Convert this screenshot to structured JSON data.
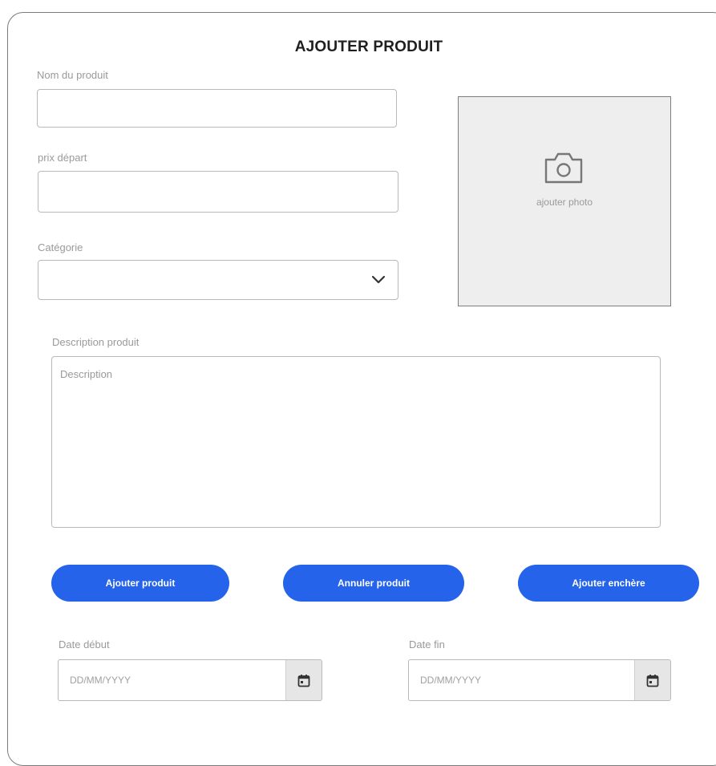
{
  "form": {
    "title": "AJOUTER PRODUIT",
    "product_name": {
      "label": "Nom du produit",
      "value": ""
    },
    "start_price": {
      "label": "prix départ",
      "value": ""
    },
    "category": {
      "label": "Catégorie",
      "selected": ""
    },
    "photo": {
      "label": "ajouter photo",
      "icon": "camera-icon"
    },
    "description": {
      "label": "Description produit",
      "placeholder": "Description"
    },
    "buttons": {
      "add_product": "Ajouter produit",
      "cancel_product": "Annuler produit",
      "add_auction": "Ajouter enchère"
    },
    "start_date": {
      "label": "Date début",
      "placeholder": "DD/MM/YYYY",
      "icon": "calendar-icon"
    },
    "end_date": {
      "label": "Date fin",
      "placeholder": "DD/MM/YYYY",
      "icon": "calendar-icon"
    }
  },
  "colors": {
    "primary": "#2563eb",
    "border": "#b9b9b9",
    "photo_bg": "#eeeeee",
    "label": "#9a9a9a"
  }
}
